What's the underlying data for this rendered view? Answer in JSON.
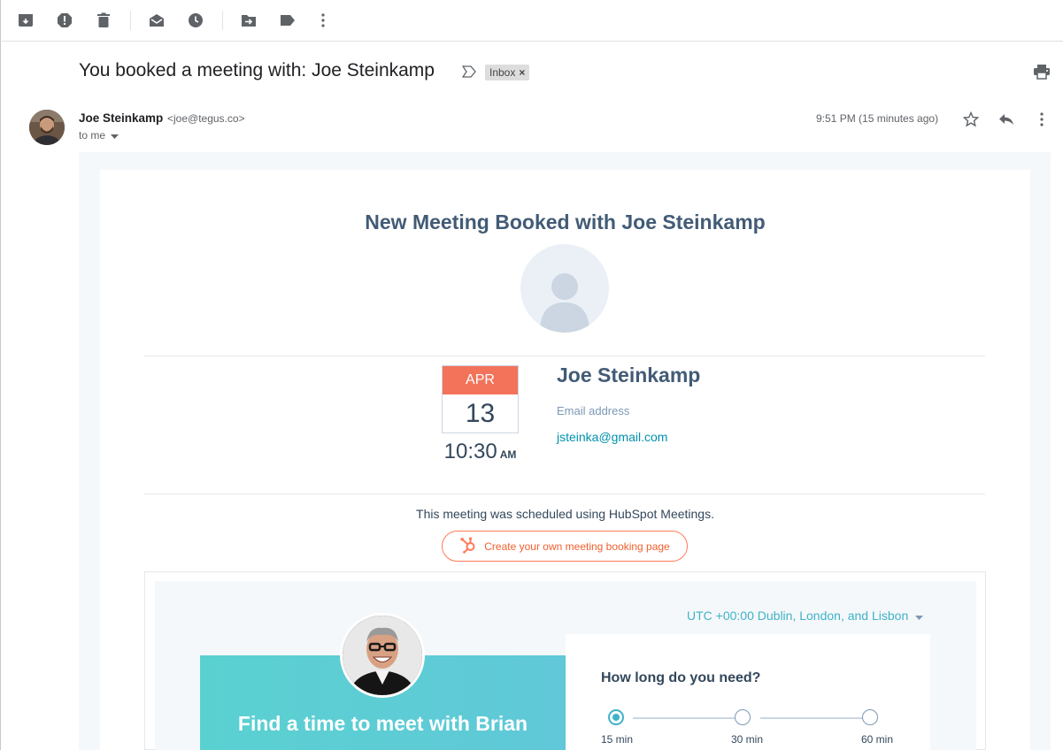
{
  "toolbar": {
    "icons": [
      "archive-icon",
      "report-spam-icon",
      "delete-icon",
      "mark-unread-icon",
      "snooze-icon",
      "move-to-icon",
      "label-icon",
      "more-vert-icon"
    ]
  },
  "message": {
    "subject": "You booked a meeting with: Joe Steinkamp",
    "label_chip": "Inbox",
    "sender_name": "Joe Steinkamp",
    "sender_email": "<joe@tegus.co>",
    "recipient": "to me",
    "time": "9:51 PM (15 minutes ago)"
  },
  "email": {
    "headline": "New Meeting Booked with Joe Steinkamp",
    "calendar": {
      "month": "APR",
      "day": "13",
      "time": "10:30",
      "ampm": "AM"
    },
    "contact_name": "Joe Steinkamp",
    "email_label": "Email address",
    "email_value": "jsteinka@gmail.com",
    "scheduled_note": "This meeting was scheduled using HubSpot Meetings.",
    "cta_label": "Create your own meeting booking page",
    "brand_color": "#ff7a59",
    "accent_color": "#3fb2c8"
  },
  "preview": {
    "timezone": "UTC +00:00 Dublin, London, and Lisbon",
    "banner_text": "Find a time to meet with Brian",
    "duration_title": "How long do you need?",
    "durations": [
      "15 min",
      "30 min",
      "60 min"
    ],
    "selected_duration": "15 min"
  }
}
